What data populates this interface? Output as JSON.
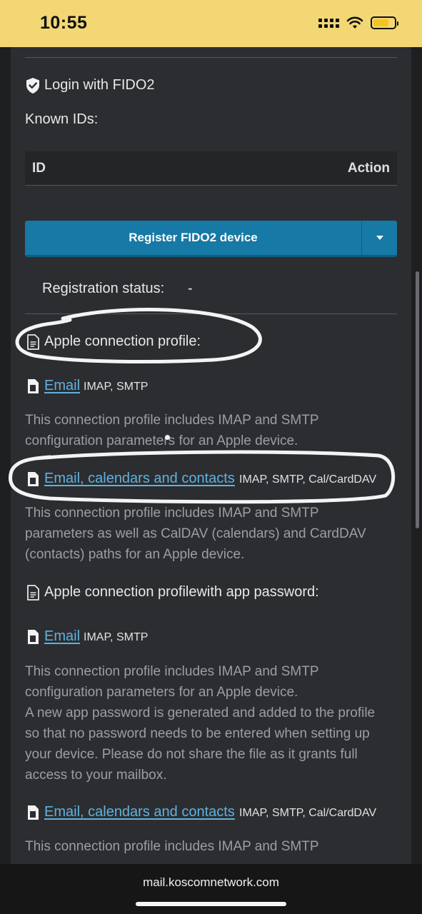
{
  "status_bar": {
    "time": "10:55",
    "battery_level": 0.75
  },
  "fido": {
    "heading": "Login with FIDO2",
    "known_ids_label": "Known IDs:",
    "table": {
      "columns": [
        "ID",
        "Action"
      ]
    },
    "register_button": "Register FIDO2 device",
    "status_label": "Registration status:",
    "status_value": "-"
  },
  "profiles": {
    "section1_heading": "Apple connection profile:",
    "section1_items": [
      {
        "link": "Email",
        "protocols": "IMAP, SMTP",
        "description": "This connection profile includes IMAP and SMTP configuration parameters for an Apple device."
      },
      {
        "link": "Email, calendars and contacts",
        "protocols": "IMAP, SMTP, Cal/CardDAV",
        "description": "This connection profile includes IMAP and SMTP parameters as well as CalDAV (calendars) and CardDAV (contacts) paths for an Apple device."
      }
    ],
    "section2_heading": "Apple connection profilewith app password:",
    "section2_items": [
      {
        "link": "Email",
        "protocols": "IMAP, SMTP",
        "description": "This connection profile includes IMAP and SMTP configuration parameters for an Apple device.",
        "description2": "A new app password is generated and added to the profile so that no password needs to be entered when setting up your device. Please do not share the file as it grants full access to your mailbox."
      },
      {
        "link": "Email, calendars and contacts",
        "protocols": "IMAP, SMTP, Cal/CardDAV",
        "description": "This connection profile includes IMAP and SMTP"
      }
    ]
  },
  "browser": {
    "url": "mail.koscomnetwork.com"
  }
}
